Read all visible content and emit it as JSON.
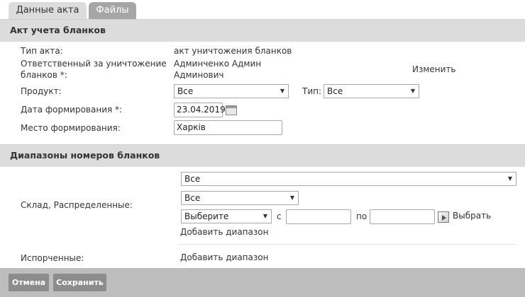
{
  "tabs": [
    {
      "label": "Данные акта",
      "active": true
    },
    {
      "label": "Файлы",
      "active": false
    }
  ],
  "act_section": {
    "title": "Акт учета бланков",
    "type_label": "Тип акта:",
    "type_value": "акт уничтожения бланков",
    "responsible_label_line1": "Ответственный за уничтожение",
    "responsible_label_line2": "бланков *:",
    "responsible_value_line1": "Админченко Админ",
    "responsible_value_line2": "Админович",
    "change_link": "Изменить",
    "product_label": "Продукт:",
    "product_value": "Все",
    "type2_label": "Тип:",
    "type2_value": "Все",
    "date_label": "Дата формирования *:",
    "date_value": "23.04.2019",
    "place_label": "Место формирования:",
    "place_value": "Харків"
  },
  "ranges_section": {
    "title": "Диапазоны номеров бланков",
    "warehouse_label": "Склад, Распределенные:",
    "select_all_wide": "Все",
    "select_all_mid": "Все",
    "select_choose": "Выберите",
    "from_label": "с",
    "to_label": "по",
    "from_value": "",
    "to_value": "",
    "pick_label": "Выбрать",
    "add_range_1": "Добавить диапазон",
    "spoiled_label": "Испорченные:",
    "add_range_2": "Добавить диапазон"
  },
  "footer": {
    "cancel": "Отмена",
    "save": "Сохранить"
  },
  "icons": {
    "calendar": "calendar-icon",
    "picker": "picker-icon",
    "dropdown": "chevron-down-icon"
  }
}
